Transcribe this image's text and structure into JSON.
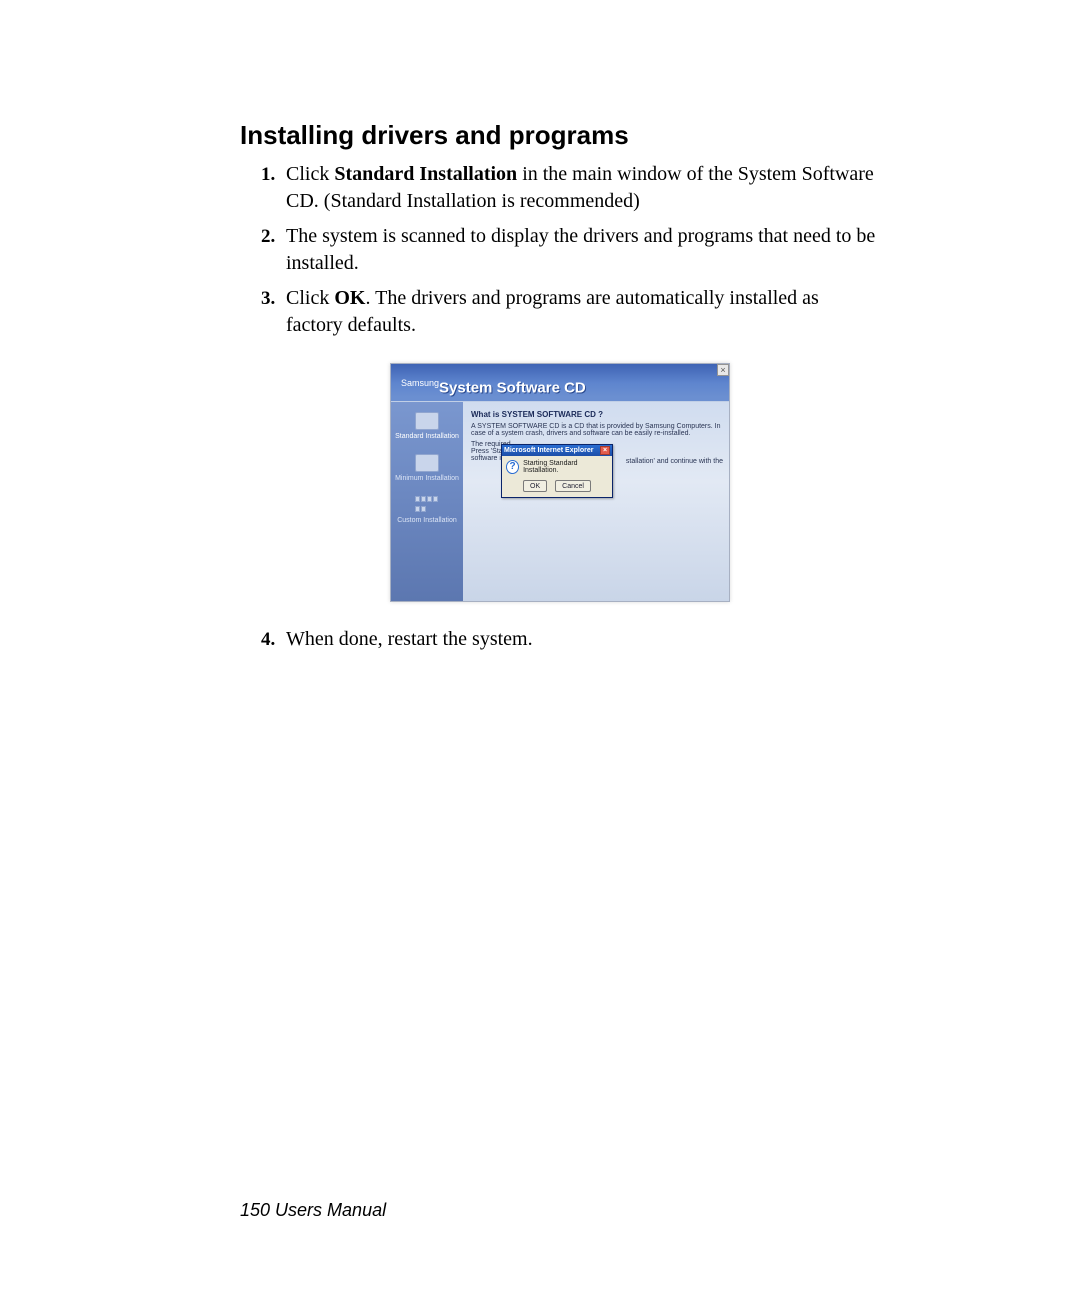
{
  "heading": "Installing drivers and programs",
  "steps": {
    "s1_pre": "Click ",
    "s1_bold": "Standard Installation",
    "s1_post": " in the main window of the System Software CD. (Standard Installation is recommended)",
    "s2": "The system is scanned to display the drivers and programs that need to be installed.",
    "s3_pre": "Click ",
    "s3_bold": "OK",
    "s3_post": ". The drivers and programs are automatically installed as factory defaults.",
    "s4": "When done, restart the system."
  },
  "figure": {
    "close_x": "×",
    "brand": "Samsung",
    "title": "System Software CD",
    "sidebar": {
      "standard": "Standard Installation",
      "minimum": "Minimum Installation",
      "custom": "Custom Installation"
    },
    "main": {
      "question": "What is SYSTEM SOFTWARE CD ?",
      "desc": "A SYSTEM SOFTWARE CD is a CD that is provided by Samsung Computers. In case of a system crash, drivers and software can be easily re-installed.",
      "line2a": "The required",
      "line2b": "Press 'Standa",
      "line2c": "software inst",
      "trail": "stallation' and continue with the"
    },
    "dialog": {
      "title": "Microsoft Internet Explorer",
      "close": "×",
      "q": "?",
      "message": "Starting Standard Installation.",
      "ok": "OK",
      "cancel": "Cancel"
    }
  },
  "footer": {
    "page": "150",
    "label": "  Users Manual"
  }
}
